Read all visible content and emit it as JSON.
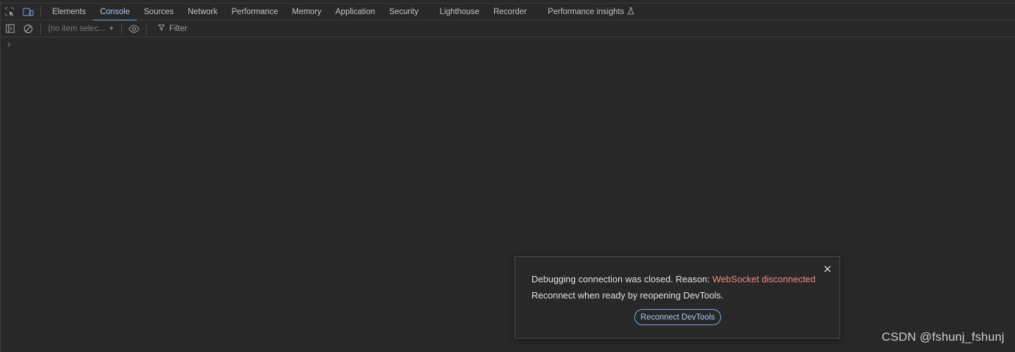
{
  "tabbar": {
    "tabs": [
      {
        "label": "Elements",
        "active": false
      },
      {
        "label": "Console",
        "active": true
      },
      {
        "label": "Sources",
        "active": false
      },
      {
        "label": "Network",
        "active": false
      },
      {
        "label": "Performance",
        "active": false
      },
      {
        "label": "Memory",
        "active": false
      },
      {
        "label": "Application",
        "active": false
      },
      {
        "label": "Security",
        "active": false
      },
      {
        "label": "Lighthouse",
        "active": false
      },
      {
        "label": "Recorder",
        "active": false
      },
      {
        "label": "Performance insights",
        "active": false
      }
    ],
    "icons": [
      "inspect-element-icon",
      "device-toolbar-icon",
      "flask-icon"
    ]
  },
  "toolbar": {
    "context_value": "(no item selec...",
    "filter_placeholder": "Filter",
    "icons": [
      "sidebar-toggle-icon",
      "clear-console-icon",
      "eye-icon",
      "filter-icon",
      "chevron-down-icon"
    ]
  },
  "console": {
    "prompt_symbol": "›"
  },
  "dialog": {
    "message_prefix": "Debugging connection was closed. Reason: ",
    "reason": "WebSocket disconnected",
    "message_line2": "Reconnect when ready by reopening DevTools.",
    "button_label": "Reconnect DevTools",
    "close_icon": "close-icon"
  },
  "watermark": "CSDN @fshunj_fshunj",
  "colors": {
    "background": "#282828",
    "accent": "#7cacf8",
    "accent_text": "#a8c7fa",
    "error_text": "#f28b82",
    "text": "#c7c7c7"
  }
}
